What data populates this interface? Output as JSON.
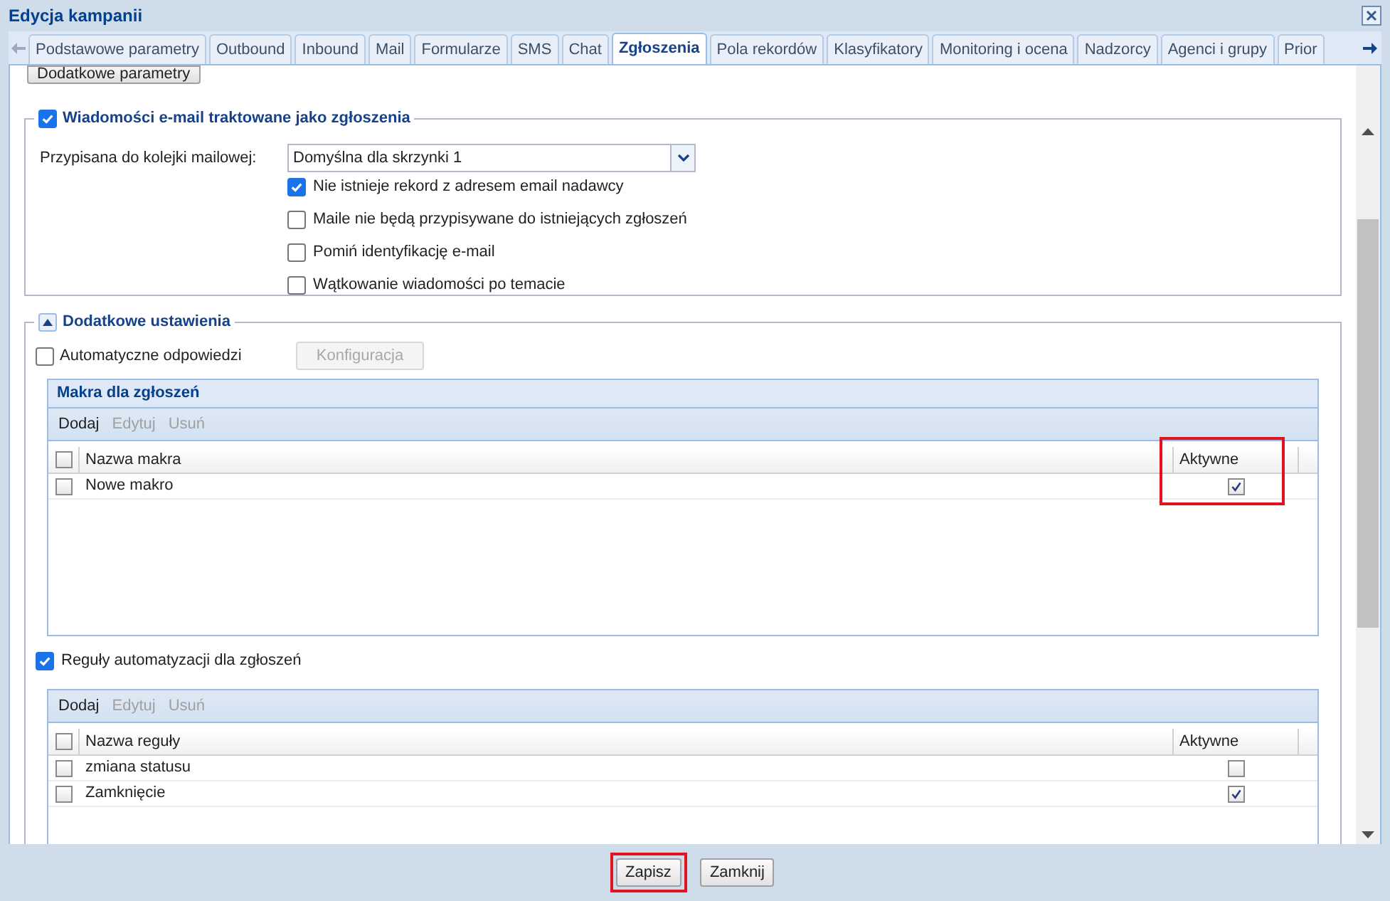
{
  "window": {
    "title": "Edycja kampanii"
  },
  "tabs": [
    {
      "label": "Podstawowe parametry",
      "selected": false
    },
    {
      "label": "Outbound",
      "selected": false
    },
    {
      "label": "Inbound",
      "selected": false
    },
    {
      "label": "Mail",
      "selected": false
    },
    {
      "label": "Formularze",
      "selected": false
    },
    {
      "label": "SMS",
      "selected": false
    },
    {
      "label": "Chat",
      "selected": false
    },
    {
      "label": "Zgłoszenia",
      "selected": true
    },
    {
      "label": "Pola rekordów",
      "selected": false
    },
    {
      "label": "Klasyfikatory",
      "selected": false
    },
    {
      "label": "Monitoring i ocena",
      "selected": false
    },
    {
      "label": "Nadzorcy",
      "selected": false
    },
    {
      "label": "Agenci i grupy",
      "selected": false
    },
    {
      "label": "Prior",
      "selected": false
    }
  ],
  "top_button": "Dodatkowe parametry",
  "email_section": {
    "legend": "Wiadomości e-mail traktowane jako zgłoszenia",
    "checked": true,
    "queue_label": "Przypisana do kolejki mailowej:",
    "queue_value": "Domyślna dla skrzynki 1",
    "options": [
      {
        "label": "Nie istnieje rekord z adresem email nadawcy",
        "checked": true
      },
      {
        "label": "Maile nie będą przypisywane do istniejących zgłoszeń",
        "checked": false
      },
      {
        "label": "Pomiń identyfikację e-mail",
        "checked": false
      },
      {
        "label": "Wątkowanie wiadomości po temacie",
        "checked": false
      }
    ]
  },
  "extra_section": {
    "legend": "Dodatkowe ustawienia",
    "expanded": true,
    "auto_reply": {
      "label": "Automatyczne odpowiedzi",
      "checked": false
    },
    "config_button": {
      "label": "Konfiguracja",
      "disabled": true
    },
    "macros": {
      "title": "Makra dla zgłoszeń",
      "toolbar": [
        {
          "label": "Dodaj",
          "disabled": false
        },
        {
          "label": "Edytuj",
          "disabled": true
        },
        {
          "label": "Usuń",
          "disabled": true
        }
      ],
      "columns": [
        "Nazwa makra",
        "Aktywne"
      ],
      "active_column_highlighted": true,
      "all_checked": false,
      "rows": [
        {
          "name": "Nowe makro",
          "checked": false,
          "active": true
        }
      ]
    },
    "rules_toggle": {
      "label": "Reguły automatyzacji dla zgłoszeń",
      "checked": true
    },
    "rules": {
      "toolbar": [
        {
          "label": "Dodaj",
          "disabled": false
        },
        {
          "label": "Edytuj",
          "disabled": true
        },
        {
          "label": "Usuń",
          "disabled": true
        }
      ],
      "columns": [
        "Nazwa reguły",
        "Aktywne"
      ],
      "all_checked": false,
      "rows": [
        {
          "name": "zmiana statusu",
          "checked": false,
          "active": false
        },
        {
          "name": "Zamknięcie",
          "checked": false,
          "active": true
        }
      ]
    }
  },
  "footer": [
    {
      "label": "Zapisz",
      "highlighted": true
    },
    {
      "label": "Zamknij",
      "highlighted": false
    }
  ]
}
